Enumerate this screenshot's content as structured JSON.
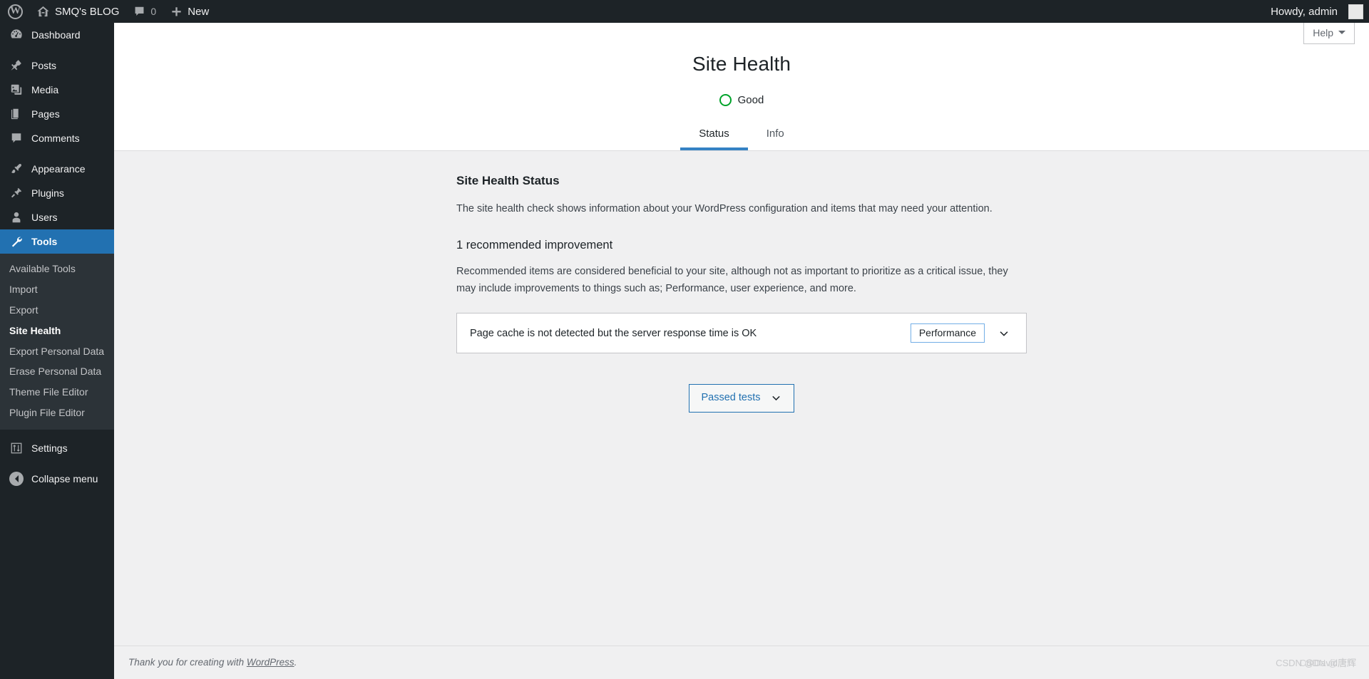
{
  "adminbar": {
    "logo_icon": "wordpress-logo-icon",
    "site_icon": "home-icon",
    "site_name": "SMQ's BLOG",
    "comments_icon": "comment-bubble-icon",
    "comments_count": "0",
    "new_icon": "plus-icon",
    "new_label": "New",
    "howdy": "Howdy, admin",
    "avatar": "user-avatar"
  },
  "sidebar": {
    "items": [
      {
        "label": "Dashboard",
        "icon": "dashboard-icon",
        "current": false,
        "gap_after": true
      },
      {
        "label": "Posts",
        "icon": "pin-icon",
        "current": false,
        "gap_after": false
      },
      {
        "label": "Media",
        "icon": "media-icon",
        "current": false,
        "gap_after": false
      },
      {
        "label": "Pages",
        "icon": "pages-icon",
        "current": false,
        "gap_after": false
      },
      {
        "label": "Comments",
        "icon": "comment-bubble-icon",
        "current": false,
        "gap_after": true
      },
      {
        "label": "Appearance",
        "icon": "paintbrush-icon",
        "current": false,
        "gap_after": false
      },
      {
        "label": "Plugins",
        "icon": "plug-icon",
        "current": false,
        "gap_after": false
      },
      {
        "label": "Users",
        "icon": "user-icon",
        "current": false,
        "gap_after": false
      },
      {
        "label": "Tools",
        "icon": "wrench-icon",
        "current": true,
        "gap_after": false
      }
    ],
    "tools_submenu": [
      {
        "label": "Available Tools",
        "current": false
      },
      {
        "label": "Import",
        "current": false
      },
      {
        "label": "Export",
        "current": false
      },
      {
        "label": "Site Health",
        "current": true
      },
      {
        "label": "Export Personal Data",
        "current": false
      },
      {
        "label": "Erase Personal Data",
        "current": false
      },
      {
        "label": "Theme File Editor",
        "current": false
      },
      {
        "label": "Plugin File Editor",
        "current": false
      }
    ],
    "settings": {
      "label": "Settings",
      "icon": "settings-sliders-icon"
    },
    "collapse": {
      "label": "Collapse menu",
      "icon": "collapse-arrow-icon"
    }
  },
  "screen_meta": {
    "help_label": "Help",
    "help_caret_icon": "caret-down-icon"
  },
  "page": {
    "title": "Site Health",
    "status_icon": "green-circle-icon",
    "status_label": "Good",
    "status_color": "#00a32a",
    "tabs": [
      {
        "label": "Status",
        "active": true
      },
      {
        "label": "Info",
        "active": false
      }
    ]
  },
  "status_section": {
    "heading": "Site Health Status",
    "description": "The site health check shows information about your WordPress configuration and items that may need your attention.",
    "issue_heading": "1 recommended improvement",
    "issue_description": "Recommended items are considered beneficial to your site, although not as important to prioritize as a critical issue, they may include improvements to things such as; Performance, user experience, and more.",
    "issues": [
      {
        "title": "Page cache is not detected but the server response time is OK",
        "badge": "Performance",
        "badge_border_color": "#72aee6",
        "toggle_icon": "chevron-down-icon"
      }
    ],
    "passed_tests_label": "Passed tests",
    "passed_tests_icon": "chevron-down-icon",
    "accent_color": "#2271b1"
  },
  "footer": {
    "thanks_prefix": "Thank you for creating with ",
    "link_label": "WordPress",
    "thanks_suffix": ".",
    "watermark": "CSDN @David唐辉",
    "watermark_overlay": "CSDN @唐辉"
  }
}
